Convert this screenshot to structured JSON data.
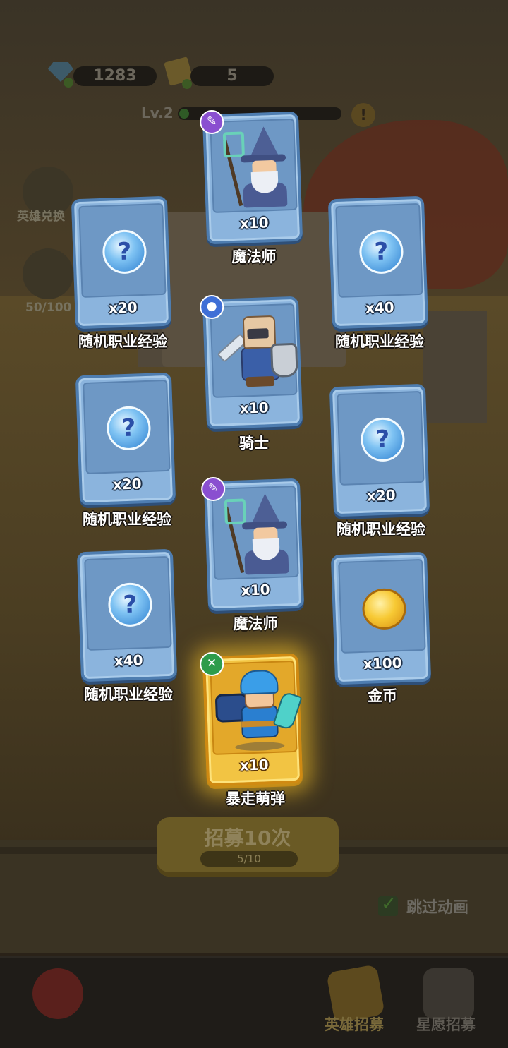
{
  "hud": {
    "gems": "1283",
    "tickets": "5",
    "level": "Lv.2",
    "warn": "!"
  },
  "side": {
    "hero_exchange_label": "英雄兑换",
    "star_progress": "50/100"
  },
  "cards": [
    {
      "name": "魔法师",
      "qty": "x10",
      "type": "wizard",
      "badge": "mage-icon",
      "badge_glyph": "✎"
    },
    {
      "name": "随机职业经验",
      "qty": "x20",
      "type": "orb",
      "glyph": "?"
    },
    {
      "name": "随机职业经验",
      "qty": "x40",
      "type": "orb",
      "glyph": "?"
    },
    {
      "name": "骑士",
      "qty": "x10",
      "type": "knight",
      "badge": "paw-icon",
      "badge_glyph": "●"
    },
    {
      "name": "随机职业经验",
      "qty": "x20",
      "type": "orb",
      "glyph": "?"
    },
    {
      "name": "随机职业经验",
      "qty": "x20",
      "type": "orb",
      "glyph": "?"
    },
    {
      "name": "魔法师",
      "qty": "x10",
      "type": "wizard",
      "badge": "mage-icon",
      "badge_glyph": "✎"
    },
    {
      "name": "随机职业经验",
      "qty": "x40",
      "type": "orb",
      "glyph": "?"
    },
    {
      "name": "金币",
      "qty": "x100",
      "type": "coin"
    },
    {
      "name": "暴走萌弹",
      "qty": "x10",
      "type": "hero",
      "badge": "bow-icon",
      "badge_glyph": "✕",
      "rarity": "gold"
    }
  ],
  "recruit": {
    "label": "招募10次",
    "progress": "5/10"
  },
  "skip": {
    "label": "跳过动画",
    "checked": true
  },
  "bottom_nav": {
    "hero_recruit": "英雄招募",
    "star_recruit": "星愿招募"
  },
  "colors": {
    "card_blue": "#8bb4dd",
    "card_border": "#4e7db0",
    "card_gold": "#f2c443",
    "badge_mage": "#8a4fd0",
    "badge_paw": "#3f6fd6",
    "badge_bow": "#2e9c4b"
  }
}
